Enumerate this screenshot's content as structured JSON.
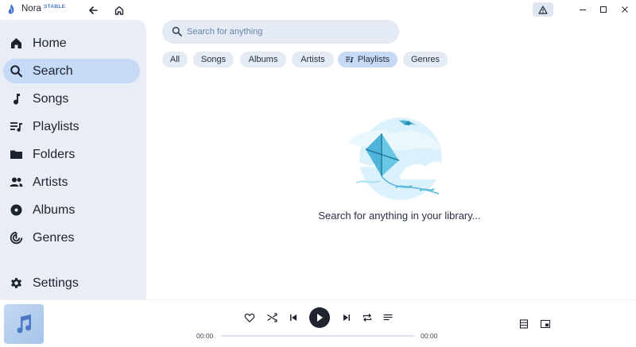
{
  "titlebar": {
    "app_name": "Nora",
    "badge": "STABLE"
  },
  "sidebar": {
    "items": [
      {
        "label": "Home",
        "icon": "home-icon",
        "active": false
      },
      {
        "label": "Search",
        "icon": "search-icon",
        "active": true
      },
      {
        "label": "Songs",
        "icon": "music-note-icon",
        "active": false
      },
      {
        "label": "Playlists",
        "icon": "playlist-icon",
        "active": false
      },
      {
        "label": "Folders",
        "icon": "folder-icon",
        "active": false
      },
      {
        "label": "Artists",
        "icon": "people-icon",
        "active": false
      },
      {
        "label": "Albums",
        "icon": "album-icon",
        "active": false
      },
      {
        "label": "Genres",
        "icon": "genre-icon",
        "active": false
      }
    ],
    "settings_label": "Settings"
  },
  "search": {
    "placeholder": "Search for anything",
    "value": ""
  },
  "filters": [
    {
      "label": "All",
      "active": false
    },
    {
      "label": "Songs",
      "active": false
    },
    {
      "label": "Albums",
      "active": false
    },
    {
      "label": "Artists",
      "active": false
    },
    {
      "label": "Playlists",
      "active": true
    },
    {
      "label": "Genres",
      "active": false
    }
  ],
  "empty_state": {
    "message": "Search for anything in your library...",
    "illustration": "kite-illustration"
  },
  "player": {
    "current_time": "00:00",
    "total_time": "00:00",
    "progress": 0
  },
  "colors": {
    "accent": "#c6daf5",
    "sidebar_bg": "#e9eef6",
    "input_bg": "#e4ebf5",
    "text": "#1f2430"
  }
}
